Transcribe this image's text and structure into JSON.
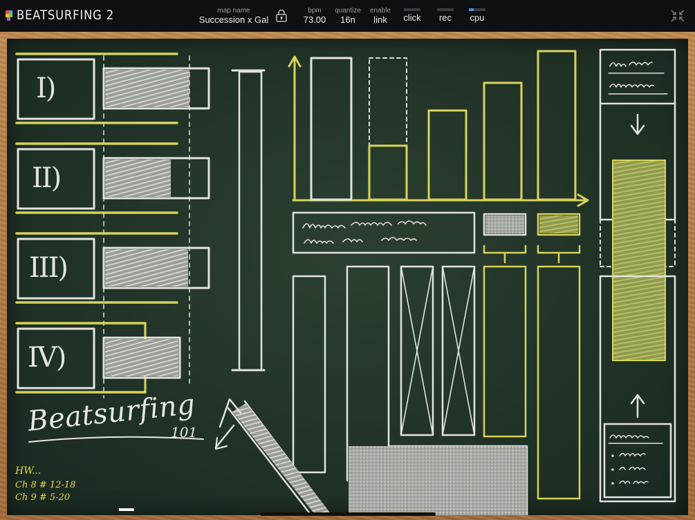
{
  "app": {
    "title": "BEATSURFING 2"
  },
  "topbar": {
    "map_name": {
      "caption": "map name",
      "value": "Succession x Gal"
    },
    "bpm": {
      "caption": "bpm",
      "value": "73.00"
    },
    "quantize": {
      "caption": "quantize",
      "value": "16n"
    },
    "link": {
      "caption": "enable",
      "value": "link"
    },
    "click": {
      "label": "click",
      "level": 0
    },
    "rec": {
      "label": "rec",
      "level": 0
    },
    "cpu": {
      "label": "cpu",
      "level": 0.3
    },
    "icons": [
      "beatsurfing-logo-icon",
      "lock-icon",
      "collapse-arrows-icon"
    ],
    "accent": "#4a8fd6"
  },
  "board": {
    "rows": [
      "I)",
      "II)",
      "III)",
      "IV)"
    ],
    "title": "Beatsurfing",
    "title_num": "101",
    "homework": {
      "heading": "HW...",
      "line1": "Ch 8 # 12-18",
      "line2": "Ch 9 # 5-20"
    },
    "colors": {
      "chalk_white": "#e4e4de",
      "chalk_yellow": "#d8d35a",
      "board": "#233628"
    }
  }
}
